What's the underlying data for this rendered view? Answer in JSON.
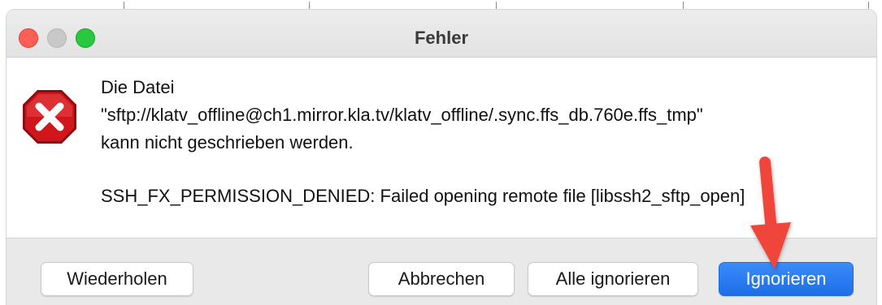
{
  "window": {
    "title": "Fehler"
  },
  "message": {
    "line1": "Die Datei",
    "line2": "\"sftp://klatv_offline@ch1.mirror.kla.tv/klatv_offline/.sync.ffs_db.760e.ffs_tmp\"",
    "line3": "kann nicht geschrieben werden.",
    "detail": "SSH_FX_PERMISSION_DENIED: Failed opening remote file [libssh2_sftp_open]"
  },
  "buttons": {
    "retry": "Wiederholen",
    "cancel": "Abbrechen",
    "ignore_all": "Alle ignorieren",
    "ignore": "Ignorieren"
  },
  "icons": {
    "error": "error-x-icon",
    "annotation": "red-arrow-icon"
  },
  "colors": {
    "close": "#fe5f57",
    "maximize": "#28c840",
    "primary_button": "#1e6de8",
    "error_icon": "#d0161b",
    "annotation_arrow": "#f0443a"
  }
}
